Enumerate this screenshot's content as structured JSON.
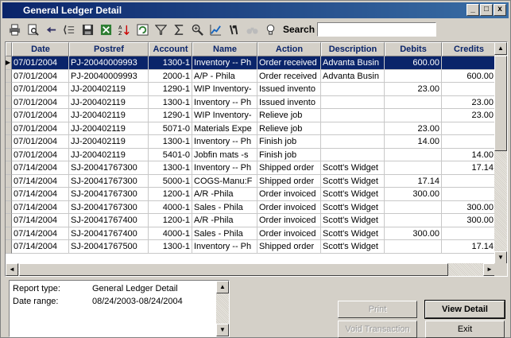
{
  "window": {
    "title": "General Ledger Detail",
    "controls": [
      "_",
      "□",
      "x"
    ]
  },
  "toolbar": {
    "icons": [
      "print-icon",
      "preview-icon",
      "export-icon",
      "columns-icon",
      "save-icon",
      "excel-icon",
      "sort-icon",
      "refresh-icon",
      "filter-icon",
      "sum-icon",
      "zoom-icon",
      "chart-icon",
      "find-icon",
      "binoculars-icon",
      "bulb-icon"
    ],
    "search_label": "Search",
    "search_value": ""
  },
  "grid": {
    "columns": [
      "Date",
      "Postref",
      "Account",
      "Name",
      "Action",
      "Description",
      "Debits",
      "Credits"
    ],
    "rows": [
      [
        "07/01/2004",
        "PJ-20040009993",
        "1300-1",
        "Inventory -- Ph",
        "Order received",
        "Advanta Busin",
        "600.00",
        ""
      ],
      [
        "07/01/2004",
        "PJ-20040009993",
        "2000-1",
        "A/P - Phila",
        "Order received",
        "Advanta Busin",
        "",
        "600.00"
      ],
      [
        "07/01/2004",
        "JJ-200402119",
        "1290-1",
        "WIP Inventory-",
        "Issued invento",
        "",
        "23.00",
        ""
      ],
      [
        "07/01/2004",
        "JJ-200402119",
        "1300-1",
        "Inventory -- Ph",
        "Issued invento",
        "",
        "",
        "23.00"
      ],
      [
        "07/01/2004",
        "JJ-200402119",
        "1290-1",
        "WIP Inventory-",
        "Relieve job",
        "",
        "",
        "23.00"
      ],
      [
        "07/01/2004",
        "JJ-200402119",
        "5071-0",
        "Materials Expe",
        "Relieve job",
        "",
        "23.00",
        ""
      ],
      [
        "07/01/2004",
        "JJ-200402119",
        "1300-1",
        "Inventory -- Ph",
        "Finish job",
        "",
        "14.00",
        ""
      ],
      [
        "07/01/2004",
        "JJ-200402119",
        "5401-0",
        "Jobfin mats -s",
        "Finish job",
        "",
        "",
        "14.00"
      ],
      [
        "07/14/2004",
        "SJ-20041767300",
        "1300-1",
        "Inventory -- Ph",
        "Shipped order",
        "Scott's Widget",
        "",
        "17.14"
      ],
      [
        "07/14/2004",
        "SJ-20041767300",
        "5000-1",
        "COGS-Manu:F",
        "Shipped order",
        "Scott's Widget",
        "17.14",
        ""
      ],
      [
        "07/14/2004",
        "SJ-20041767300",
        "1200-1",
        "A/R -Phila",
        "Order invoiced",
        "Scott's Widget",
        "300.00",
        ""
      ],
      [
        "07/14/2004",
        "SJ-20041767300",
        "4000-1",
        "Sales - Phila",
        "Order invoiced",
        "Scott's Widget",
        "",
        "300.00"
      ],
      [
        "07/14/2004",
        "SJ-20041767400",
        "1200-1",
        "A/R -Phila",
        "Order invoiced",
        "Scott's Widget",
        "",
        "300.00"
      ],
      [
        "07/14/2004",
        "SJ-20041767400",
        "4000-1",
        "Sales - Phila",
        "Order invoiced",
        "Scott's Widget",
        "300.00",
        ""
      ],
      [
        "07/14/2004",
        "SJ-20041767500",
        "1300-1",
        "Inventory -- Ph",
        "Shipped order",
        "Scott's Widget",
        "",
        "17.14"
      ]
    ]
  },
  "report": {
    "type_label": "Report type:",
    "type_value": "General Ledger Detail",
    "range_label": "Date range:",
    "range_value": "08/24/2003-08/24/2004"
  },
  "buttons": {
    "print": "Print",
    "view_detail": "View Detail",
    "void_transaction": "Void Transaction",
    "exit": "Exit"
  }
}
